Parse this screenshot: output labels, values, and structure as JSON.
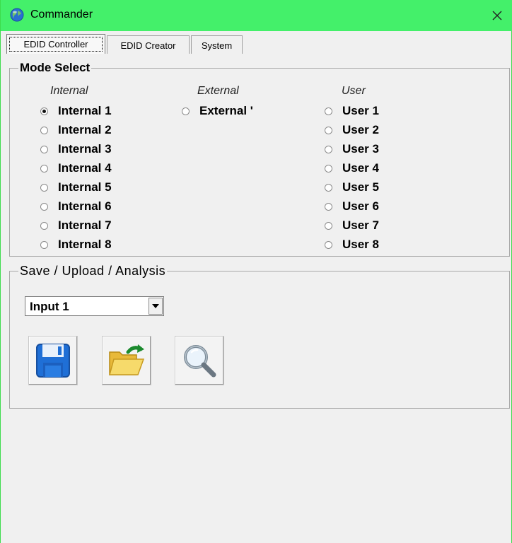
{
  "window": {
    "title": "Commander",
    "icon": "globe-icon",
    "close_icon": "close-icon"
  },
  "tabs": [
    {
      "label": "EDID Controller",
      "active": true
    },
    {
      "label": "EDID Creator",
      "active": false
    },
    {
      "label": "System",
      "active": false
    }
  ],
  "mode_select": {
    "title": "Mode Select",
    "columns": {
      "internal": {
        "heading": "Internal",
        "options": [
          "Internal 1",
          "Internal 2",
          "Internal 3",
          "Internal 4",
          "Internal 5",
          "Internal 6",
          "Internal 7",
          "Internal 8"
        ],
        "selected_index": 0
      },
      "external": {
        "heading": "External",
        "options": [
          "External '"
        ]
      },
      "user": {
        "heading": "User",
        "options": [
          "User 1",
          "User 2",
          "User 3",
          "User 4",
          "User 5",
          "User 6",
          "User 7",
          "User 8"
        ]
      }
    }
  },
  "save_upload": {
    "title": "Save / Upload / Analysis",
    "input_select": {
      "value": "Input 1",
      "icon": "chevron-down-icon"
    },
    "buttons": [
      {
        "name": "save-button",
        "icon": "floppy-disk-icon"
      },
      {
        "name": "upload-button",
        "icon": "open-folder-icon"
      },
      {
        "name": "analysis-button",
        "icon": "magnifier-icon"
      }
    ]
  },
  "colors": {
    "titlebar": "#44f06a",
    "window_bg": "#f0f0f0"
  }
}
